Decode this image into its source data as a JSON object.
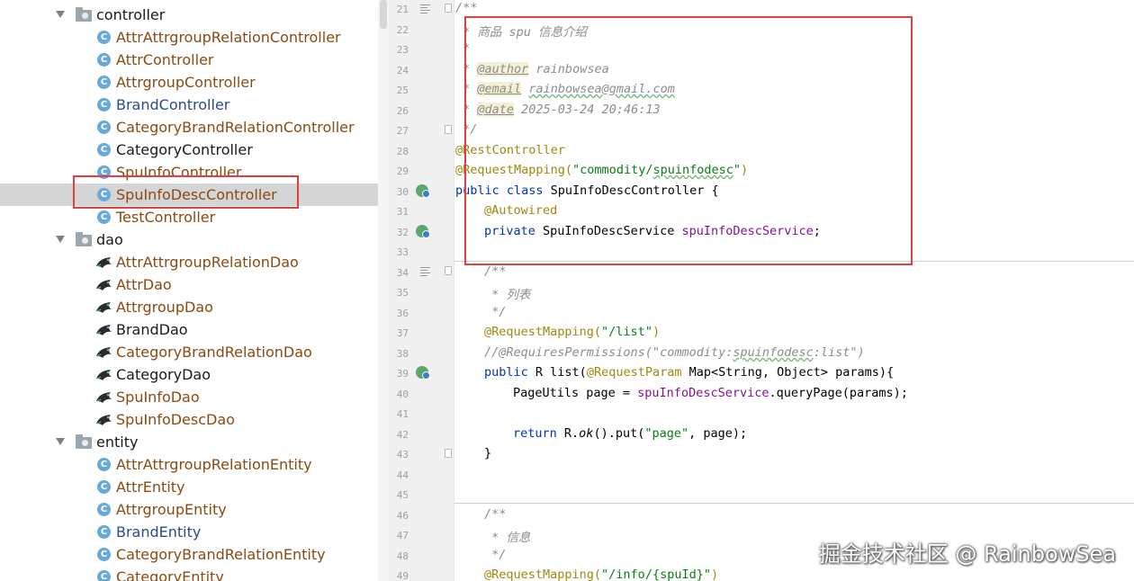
{
  "tree": {
    "items": [
      {
        "label": "controller",
        "kind": "folder",
        "color": "black"
      },
      {
        "label": "AttrAttrgroupRelationController",
        "kind": "class",
        "color": "brown"
      },
      {
        "label": "AttrController",
        "kind": "class",
        "color": "brown"
      },
      {
        "label": "AttrgroupController",
        "kind": "class",
        "color": "brown"
      },
      {
        "label": "BrandController",
        "kind": "class",
        "color": "blue"
      },
      {
        "label": "CategoryBrandRelationController",
        "kind": "class",
        "color": "brown"
      },
      {
        "label": "CategoryController",
        "kind": "class",
        "color": "black"
      },
      {
        "label": "SpuInfoController",
        "kind": "class",
        "color": "brown"
      },
      {
        "label": "SpuInfoDescController",
        "kind": "class",
        "color": "brown",
        "selected": true
      },
      {
        "label": "TestController",
        "kind": "class",
        "color": "brown"
      },
      {
        "label": "dao",
        "kind": "folder",
        "color": "black"
      },
      {
        "label": "AttrAttrgroupRelationDao",
        "kind": "dao",
        "color": "brown"
      },
      {
        "label": "AttrDao",
        "kind": "dao",
        "color": "brown"
      },
      {
        "label": "AttrgroupDao",
        "kind": "dao",
        "color": "brown"
      },
      {
        "label": "BrandDao",
        "kind": "dao",
        "color": "black"
      },
      {
        "label": "CategoryBrandRelationDao",
        "kind": "dao",
        "color": "brown"
      },
      {
        "label": "CategoryDao",
        "kind": "dao",
        "color": "black"
      },
      {
        "label": "SpuInfoDao",
        "kind": "dao",
        "color": "brown"
      },
      {
        "label": "SpuInfoDescDao",
        "kind": "dao",
        "color": "brown"
      },
      {
        "label": "entity",
        "kind": "folder",
        "color": "black"
      },
      {
        "label": "AttrAttrgroupRelationEntity",
        "kind": "class",
        "color": "brown"
      },
      {
        "label": "AttrEntity",
        "kind": "class",
        "color": "brown"
      },
      {
        "label": "AttrgroupEntity",
        "kind": "class",
        "color": "brown"
      },
      {
        "label": "BrandEntity",
        "kind": "class",
        "color": "blue"
      },
      {
        "label": "CategoryBrandRelationEntity",
        "kind": "class",
        "color": "brown"
      },
      {
        "label": "CategoryEntity",
        "kind": "class",
        "color": "brown"
      }
    ],
    "class_icon_letter": "C"
  },
  "editor": {
    "line_numbers": [
      "21",
      "22",
      "23",
      "24",
      "25",
      "26",
      "27",
      "28",
      "29",
      "30",
      "31",
      "32",
      "33",
      "34",
      "35",
      "36",
      "37",
      "38",
      "39",
      "40",
      "41",
      "42",
      "43",
      "44",
      "45",
      "46",
      "47",
      "48",
      "49"
    ],
    "code": {
      "l21": "/**",
      "l22": " * 商品 spu 信息介绍",
      "l23": " *",
      "l24_star": " * ",
      "l24_tag": "@author",
      "l24_val": " rainbowsea",
      "l25_star": " * ",
      "l25_tag": "@email",
      "l25_sp": " ",
      "l25_val": "rainbowsea@gmail.com",
      "l26_star": " * ",
      "l26_tag": "@date",
      "l26_val": " 2025-03-24 20:46:13",
      "l27": " */",
      "l28": "@RestController",
      "l29_ann": "@RequestMapping(",
      "l29_str_a": "\"commodity/",
      "l29_str_b": "spuinfodesc",
      "l29_str_c": "\"",
      "l29_end": ")",
      "l30_kw": "public class",
      "l30_rest": " SpuInfoDescController {",
      "l31": "@Autowired",
      "l32_kw": "private",
      "l32_type": " SpuInfoDescService ",
      "l32_fld": "spuInfoDescService",
      "l32_end": ";",
      "l34": "/**",
      "l35": " * 列表",
      "l36": " */",
      "l37_ann": "@RequestMapping(",
      "l37_str": "\"/list\"",
      "l37_end": ")",
      "l38_a": "//@RequiresPermissions(\"commodity:",
      "l38_b": "spuinfodesc",
      "l38_c": ":list\")",
      "l39_kw": "public",
      "l39_a": " R list(",
      "l39_ann": "@RequestParam",
      "l39_b": " Map<String, Object> params){",
      "l40_a": "PageUtils page = ",
      "l40_fld": "spuInfoDescService",
      "l40_b": ".queryPage(params);",
      "l42_kw": "return",
      "l42_a": " R.",
      "l42_m": "ok",
      "l42_b": "().put(",
      "l42_str": "\"page\"",
      "l42_c": ", page);",
      "l43": "}",
      "l46": "/**",
      "l47": " * 信息",
      "l48": " */",
      "l49_ann": "@RequestMapping(",
      "l49_str": "\"/info/{spuId}\"",
      "l49_end": ")"
    }
  },
  "watermark": "掘金技术社区 @ RainbowSea",
  "colors": {
    "highlight_box": "#e04040",
    "selected_row": "#d5d5d5",
    "class_icon": "#69a9d6",
    "annotation": "#9e880d",
    "keyword": "#0033b3",
    "string": "#067d17",
    "field": "#871094",
    "comment": "#8c8c8c"
  }
}
